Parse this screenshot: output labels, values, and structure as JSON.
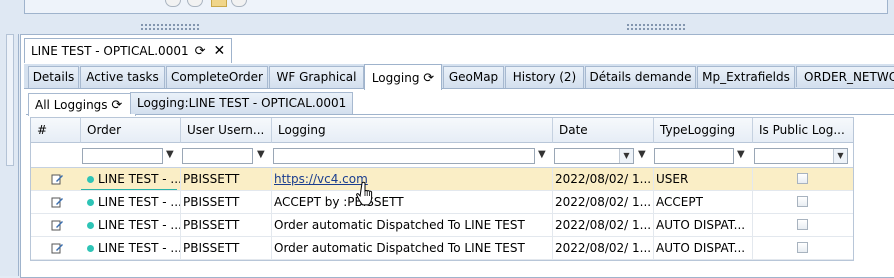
{
  "document_tab": {
    "title": "LINE TEST - OPTICAL.0001",
    "refresh_icon": "refresh-icon",
    "close_label": "✕"
  },
  "tabs": [
    {
      "label": "Details",
      "active": false
    },
    {
      "label": "Active tasks",
      "active": false
    },
    {
      "label": "CompleteOrder",
      "active": false
    },
    {
      "label": "WF Graphical",
      "active": false
    },
    {
      "label": "Logging",
      "active": true
    },
    {
      "label": "GeoMap",
      "active": false
    },
    {
      "label": "History (2)",
      "active": false
    },
    {
      "label": "Détails demande",
      "active": false
    },
    {
      "label": "Mp_Extrafields",
      "active": false
    },
    {
      "label": "ORDER_NETWO",
      "active": false
    }
  ],
  "subtabs": [
    {
      "label": "All Loggings",
      "active": true
    },
    {
      "label": "Logging:LINE TEST - OPTICAL.0001",
      "active": false
    }
  ],
  "grid": {
    "columns": [
      "#",
      "Order",
      "User Usern...",
      "Logging",
      "Date",
      "TypeLogging",
      "Is Public Log..."
    ],
    "rows": [
      {
        "order": "LINE TEST - ...",
        "user": "PBISSETT",
        "logging": "https://vc4.com",
        "date": "2022/08/02/ 1...",
        "type": "USER",
        "is_link": true,
        "selected": true
      },
      {
        "order": "LINE TEST - ...",
        "user": "PBISSETT",
        "logging": "ACCEPT by :PBISSETT",
        "date": "2022/08/02/ 1...",
        "type": "ACCEPT",
        "is_link": false,
        "selected": false
      },
      {
        "order": "LINE TEST - ...",
        "user": "PBISSETT",
        "logging": "Order automatic Dispatched To LINE TEST",
        "date": "2022/08/02/ 1...",
        "type": "AUTO DISPAT...",
        "is_link": false,
        "selected": false
      },
      {
        "order": "LINE TEST - ...",
        "user": "PBISSETT",
        "logging": "Order automatic Dispatched To LINE TEST",
        "date": "2022/08/02/ 1...",
        "type": "AUTO DISPAT...",
        "is_link": false,
        "selected": false
      }
    ]
  },
  "colors": {
    "selected_row": "#faeec6",
    "status_dot": "#2ec4b6",
    "link": "#1a3d8f"
  }
}
